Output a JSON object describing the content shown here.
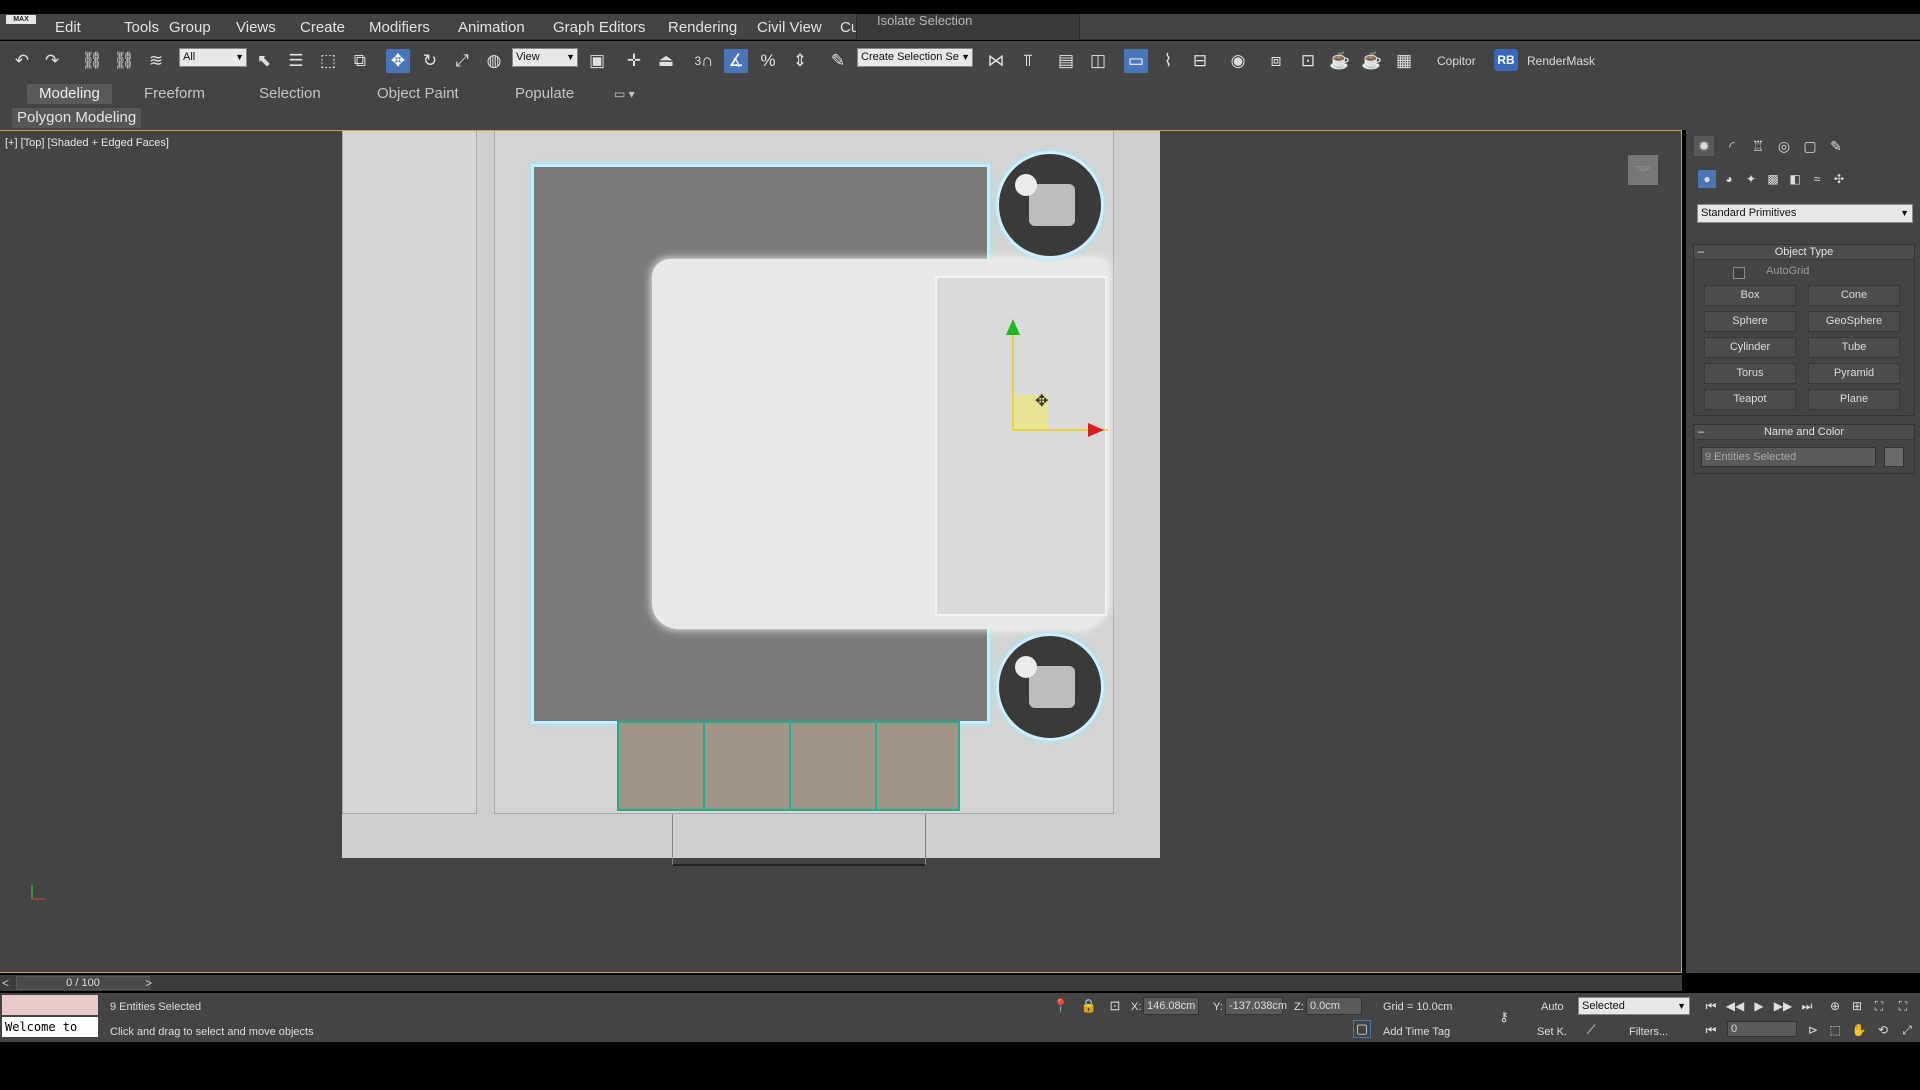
{
  "app": {
    "logo_text": "MAX"
  },
  "menu": {
    "items": [
      "Edit",
      "Tools",
      "Group",
      "Views",
      "Create",
      "Modifiers",
      "Animation",
      "Graph Editors",
      "Rendering",
      "Civil View",
      "Cu"
    ],
    "isolate_tab": "Isolate Selection"
  },
  "toolbar": {
    "selection_filter": "All",
    "ref_coord": "View",
    "snap_label": "3",
    "named_selection": "Create Selection Se",
    "copitor": "Copitor",
    "rb_badge": "RB",
    "rendermask": "RenderMask"
  },
  "ribbon": {
    "tabs": [
      "Modeling",
      "Freeform",
      "Selection",
      "Object Paint",
      "Populate"
    ],
    "panel_label": "Polygon Modeling"
  },
  "viewport": {
    "label": "[+] [Top] [Shaded + Edged Faces]",
    "viewcube": "TOP"
  },
  "command_panel": {
    "category_dropdown": "Standard Primitives",
    "object_type": {
      "title": "Object Type",
      "autogrid": "AutoGrid",
      "buttons": [
        "Box",
        "Cone",
        "Sphere",
        "GeoSphere",
        "Cylinder",
        "Tube",
        "Torus",
        "Pyramid",
        "Teapot",
        "Plane"
      ]
    },
    "name_color": {
      "title": "Name and Color",
      "name_value": "9 Entities Selected",
      "swatch_color": "#6a6a6a"
    }
  },
  "timeslider": {
    "position": "0 / 100",
    "left_arrow": "<",
    "right_arrow": ">"
  },
  "statusbar": {
    "listener_text": "Welcome to",
    "selection_count": "9 Entities Selected",
    "prompt": "Click and drag to select and move objects",
    "x_label": "X:",
    "x_value": "146.08cm",
    "y_label": "Y:",
    "y_value": "-137.038cm",
    "z_label": "Z:",
    "z_value": "0.0cm",
    "grid": "Grid = 10.0cm",
    "add_time_tag": "Add Time Tag",
    "auto_key": "Auto",
    "set_key": "Set K.",
    "key_mode": "Selected",
    "filters": "Filters...",
    "frame": "0"
  },
  "colors": {
    "accent_blue": "#4a76b8",
    "viewport_border": "#c8a040",
    "selection_glow": "#bfeeff",
    "rug_outline": "#1fae8e",
    "gizmo_x": "#d81e1e",
    "gizmo_y": "#1db81d"
  }
}
